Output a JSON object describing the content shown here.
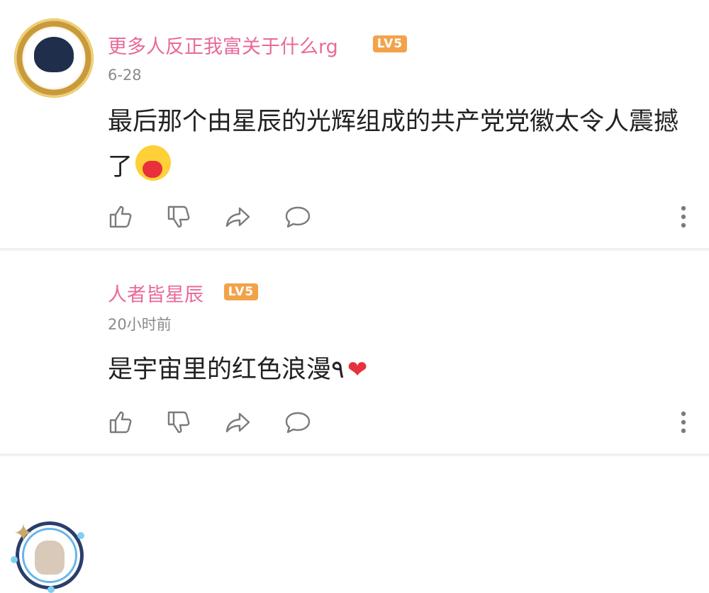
{
  "comments": [
    {
      "username": "更多人反正我富关于什么rg",
      "level": "LV5",
      "time": "6-28",
      "text": "最后那个由星辰的光辉组成的共产党党徽太令人震撼了",
      "emoji": "hug-heart-emoji"
    },
    {
      "username": "人者皆星辰",
      "level": "LV5",
      "time": "20小时前",
      "text": "是宇宙里的红色浪漫",
      "suffix": "٩",
      "emoji": "❤"
    }
  ],
  "colors": {
    "username": "#e86a9a",
    "level_badge": "#f2a34a",
    "time": "#8a8a8a",
    "text": "#222222",
    "icon": "#7b7b7b"
  },
  "icons": [
    "thumbs-up-icon",
    "thumbs-down-icon",
    "share-icon",
    "comment-icon",
    "more-icon"
  ]
}
